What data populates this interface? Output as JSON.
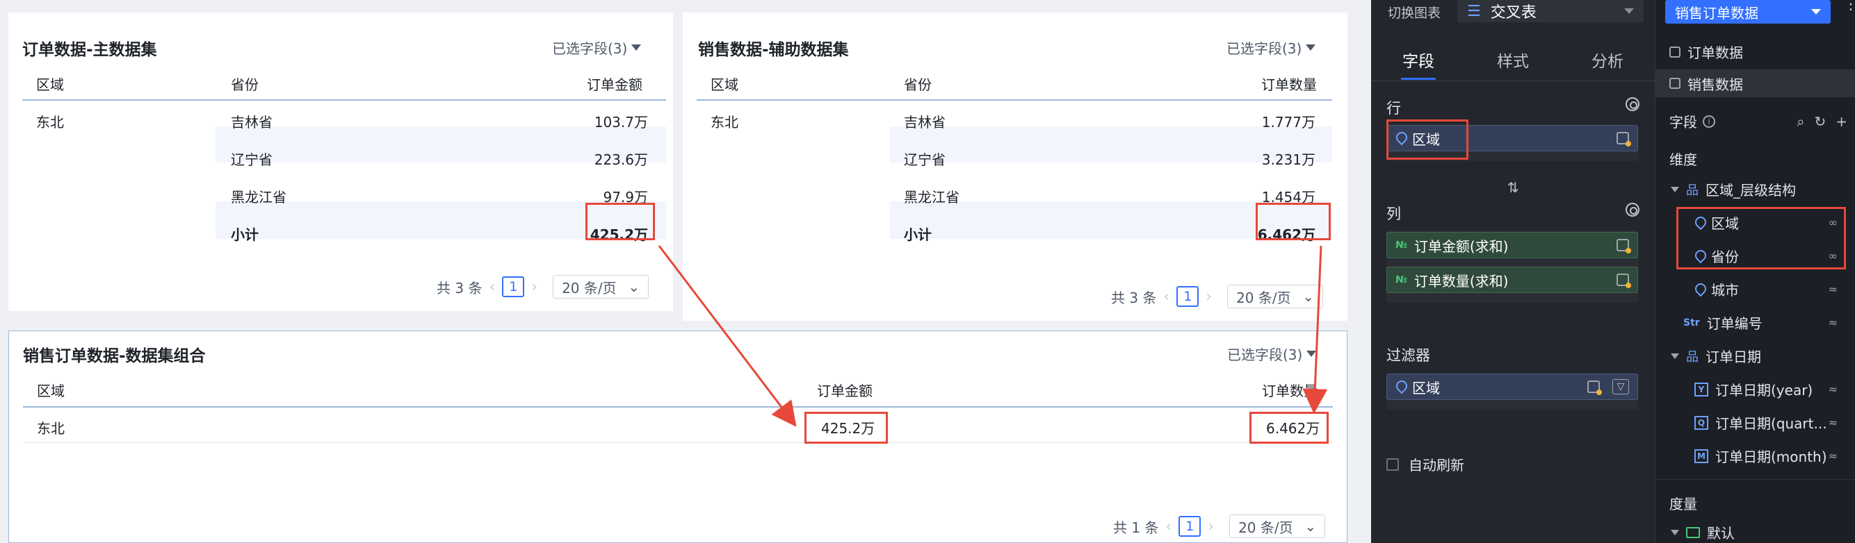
{
  "card_main": {
    "title": "订单数据-主数据集",
    "field_select": "已选字段(3)",
    "headers": [
      "区域",
      "省份",
      "订单金额"
    ],
    "rows": [
      {
        "region": "东北",
        "province": "吉林省",
        "value": "103.7万"
      },
      {
        "region": "",
        "province": "辽宁省",
        "value": "223.6万"
      },
      {
        "region": "",
        "province": "黑龙江省",
        "value": "97.9万"
      }
    ],
    "subtotal_label": "小计",
    "subtotal_value": "425.2万",
    "pager": {
      "total": "共 3 条",
      "page": "1",
      "size": "20 条/页"
    }
  },
  "card_aux": {
    "title": "销售数据-辅助数据集",
    "field_select": "已选字段(3)",
    "headers": [
      "区域",
      "省份",
      "订单数量"
    ],
    "rows": [
      {
        "region": "东北",
        "province": "吉林省",
        "value": "1.777万"
      },
      {
        "region": "",
        "province": "辽宁省",
        "value": "3.231万"
      },
      {
        "region": "",
        "province": "黑龙江省",
        "value": "1.454万"
      }
    ],
    "subtotal_label": "小计",
    "subtotal_value": "6.462万",
    "pager": {
      "total": "共 3 条",
      "page": "1",
      "size": "20 条/页"
    }
  },
  "card_combo": {
    "title": "销售订单数据-数据集组合",
    "field_select": "已选字段(3)",
    "headers": [
      "区域",
      "订单金额",
      "订单数量"
    ],
    "row": {
      "region": "东北",
      "amount": "425.2万",
      "qty": "6.462万"
    },
    "pager": {
      "total": "共 1 条",
      "page": "1",
      "size": "20 条/页"
    }
  },
  "config": {
    "switch_label": "切换图表",
    "chart_type": "交叉表",
    "tabs": [
      "字段",
      "样式",
      "分析"
    ],
    "row_label": "行",
    "row_chip": "区域",
    "col_label": "列",
    "col_chips": [
      "订单金额(求和)",
      "订单数量(求和)"
    ],
    "num_tag": "№",
    "filter_label": "过滤器",
    "filter_chip": "区域",
    "auto_refresh": "自动刷新",
    "swap_icon": "⇅"
  },
  "fields": {
    "dataset": "销售订单数据",
    "datasets": [
      "订单数据",
      "销售数据"
    ],
    "field_label": "字段",
    "dimension_label": "维度",
    "hierarchy": "区域_层级结构",
    "hier_items": [
      "区域",
      "省份",
      "城市"
    ],
    "order_no": "订单编号",
    "str_tag": "Str",
    "date_group": "订单日期",
    "date_items": [
      {
        "tag": "Y",
        "label": "订单日期(year)"
      },
      {
        "tag": "Q",
        "label": "订单日期(quart..."
      },
      {
        "tag": "M",
        "label": "订单日期(month)"
      }
    ],
    "measure_label": "度量",
    "default_folder": "默认"
  },
  "colors": {
    "highlight": "#e8483a",
    "accent": "#3370ff",
    "dark_panel": "#23262d"
  }
}
